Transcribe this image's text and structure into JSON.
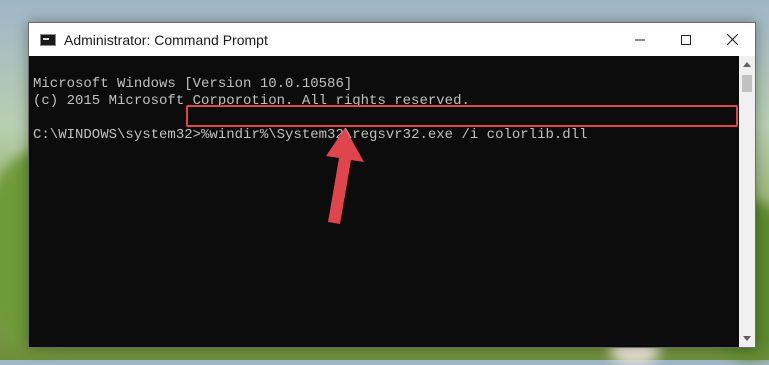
{
  "window": {
    "title": "Administrator: Command Prompt"
  },
  "console": {
    "lines": [
      "Microsoft Windows [Version 10.0.10586]",
      "(c) 2015 Microsoft Corporotion. All rights reserved."
    ],
    "prompt": "C:\\WINDOWS\\system32>",
    "command": "%windir%\\System32\\regsvr32.exe /i colorlib.dll"
  },
  "colors": {
    "highlight": "#e0454e",
    "console_bg": "#0c0c0c",
    "console_text": "#c0c0c0"
  },
  "icons": [
    "cmd-icon",
    "minimize-icon",
    "maximize-icon",
    "close-icon",
    "scroll-up-icon",
    "scroll-down-icon",
    "red-arrow-icon"
  ]
}
